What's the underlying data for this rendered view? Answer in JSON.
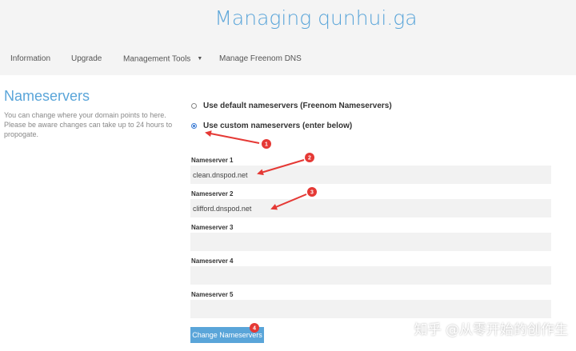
{
  "header": {
    "title": "Managing qunhui.ga",
    "nav": [
      {
        "label": "Information"
      },
      {
        "label": "Upgrade"
      },
      {
        "label": "Management Tools",
        "has_dropdown": true
      },
      {
        "label": "Manage Freenom DNS"
      }
    ]
  },
  "section": {
    "title": "Nameservers",
    "description": "You can change where your domain points to here. Please be aware changes can take up to 24 hours to propogate."
  },
  "options": {
    "default_label": "Use default nameservers (Freenom Nameservers)",
    "custom_label": "Use custom nameservers (enter below)",
    "selected": "custom"
  },
  "nameservers": [
    {
      "label": "Nameserver 1",
      "value": "clean.dnspod.net"
    },
    {
      "label": "Nameserver 2",
      "value": "clifford.dnspod.net"
    },
    {
      "label": "Nameserver 3",
      "value": ""
    },
    {
      "label": "Nameserver 4",
      "value": ""
    },
    {
      "label": "Nameserver 5",
      "value": ""
    }
  ],
  "submit_label": "Change Nameservers",
  "annotations": [
    "1",
    "2",
    "3",
    "4"
  ],
  "annotation_color": "#e53935",
  "accent_color": "#5aa5d9",
  "watermark": "知乎 @从零开始的创作生"
}
